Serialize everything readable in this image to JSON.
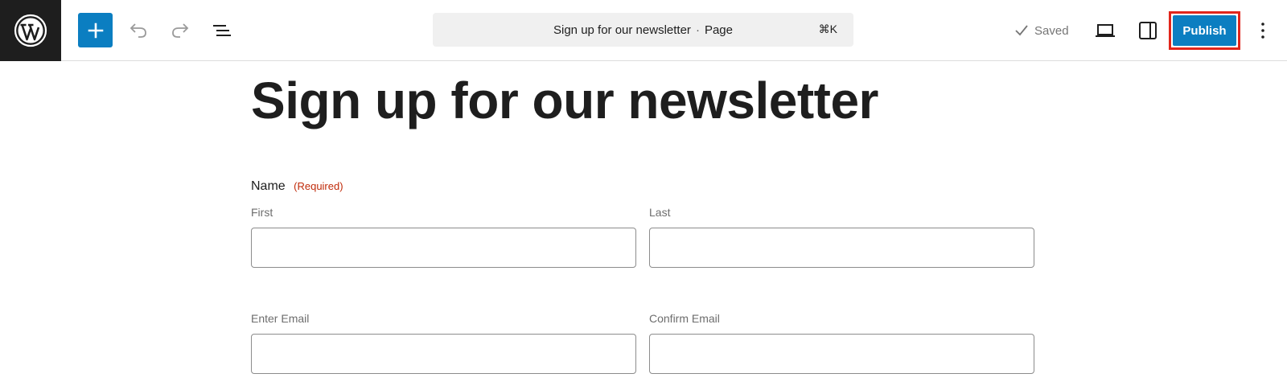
{
  "toolbar": {
    "logo_icon": "wordpress-logo-icon",
    "add_icon": "plus-icon",
    "undo_icon": "undo-icon",
    "redo_icon": "redo-icon",
    "list_view_icon": "list-view-icon",
    "command_title": "Sign up for our newsletter",
    "command_separator": "·",
    "command_type": "Page",
    "command_shortcut": "⌘K",
    "saved_label": "Saved",
    "preview_icon": "laptop-icon",
    "settings_icon": "sidebar-icon",
    "publish_label": "Publish",
    "options_icon": "more-vertical-icon",
    "accent_color": "#0b7ec1",
    "highlight_color": "#e1251b"
  },
  "content": {
    "title": "Sign up for our newsletter",
    "name_field": {
      "label": "Name",
      "required_text": "(Required)",
      "first_label": "First",
      "first_value": "",
      "last_label": "Last",
      "last_value": ""
    },
    "email_field": {
      "enter_label": "Enter Email",
      "enter_value": "",
      "confirm_label": "Confirm Email",
      "confirm_value": ""
    }
  }
}
